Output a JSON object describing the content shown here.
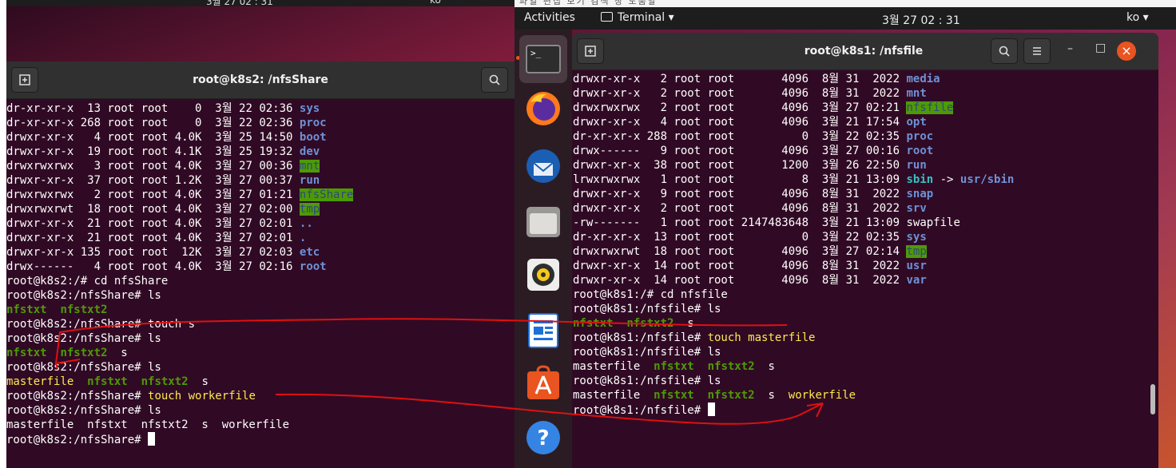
{
  "left": {
    "topbar": {
      "clock": "3월 27 02 : 31",
      "lang": "ko"
    },
    "window": {
      "title": "root@k8s2: /nfsShare",
      "new_tab_icon": "new-tab-icon",
      "search_icon": "search-icon"
    },
    "lines": [
      {
        "text": "dr-xr-xr-x  13 root root    0  3월 22 02:36 ",
        "name": "sys",
        "style": "c-blue"
      },
      {
        "text": "dr-xr-xr-x 268 root root    0  3월 22 02:36 ",
        "name": "proc",
        "style": "c-blue"
      },
      {
        "text": "drwxr-xr-x   4 root root 4.0K  3월 25 14:50 ",
        "name": "boot",
        "style": "c-blue"
      },
      {
        "text": "drwxr-xr-x  19 root root 4.1K  3월 25 19:32 ",
        "name": "dev",
        "style": "c-blue"
      },
      {
        "text": "drwxrwxrwx   3 root root 4.0K  3월 27 00:36 ",
        "name": "mnt",
        "style": "c-ow"
      },
      {
        "text": "drwxr-xr-x  37 root root 1.2K  3월 27 00:37 ",
        "name": "run",
        "style": "c-blue"
      },
      {
        "text": "drwxrwxrwx   2 root root 4.0K  3월 27 01:21 ",
        "name": "nfsShare",
        "style": "c-ow"
      },
      {
        "text": "drwxrwxrwt  18 root root 4.0K  3월 27 02:00 ",
        "name": "tmp",
        "style": "c-ow"
      },
      {
        "text": "drwxr-xr-x  21 root root 4.0K  3월 27 02:01 ",
        "name": "..",
        "style": "c-blue"
      },
      {
        "text": "drwxr-xr-x  21 root root 4.0K  3월 27 02:01 ",
        "name": ".",
        "style": "c-blue"
      },
      {
        "text": "drwxr-xr-x 135 root root  12K  3월 27 02:03 ",
        "name": "etc",
        "style": "c-blue"
      },
      {
        "text": "drwx------   4 root root 4.0K  3월 27 02:16 ",
        "name": "root",
        "style": "c-blue"
      },
      {
        "text": "root@k8s2:/# cd nfsShare"
      },
      {
        "text": "root@k8s2:/nfsShare# ls"
      },
      {
        "parts": [
          {
            "t": "nfstxt",
            "s": "c-green"
          },
          {
            "t": "  "
          },
          {
            "t": "nfstxt2",
            "s": "c-green"
          }
        ]
      },
      {
        "text": "root@k8s2:/nfsShare# touch s"
      },
      {
        "text": "root@k8s2:/nfsShare# ls"
      },
      {
        "parts": [
          {
            "t": "nfstxt",
            "s": "c-green"
          },
          {
            "t": "  "
          },
          {
            "t": "nfstxt2",
            "s": "c-green"
          },
          {
            "t": "  s"
          }
        ]
      },
      {
        "text": "root@k8s2:/nfsShare# ls"
      },
      {
        "parts": [
          {
            "t": "masterfile",
            "s": "c-yellow"
          },
          {
            "t": "  "
          },
          {
            "t": "nfstxt",
            "s": "c-green"
          },
          {
            "t": "  "
          },
          {
            "t": "nfstxt2",
            "s": "c-green"
          },
          {
            "t": "  s"
          }
        ]
      },
      {
        "parts": [
          {
            "t": "root@k8s2:/nfsShare# "
          },
          {
            "t": "touch workerfile",
            "s": "c-yellow"
          }
        ]
      },
      {
        "text": "root@k8s2:/nfsShare# ls"
      },
      {
        "text": "masterfile  nfstxt  nfstxt2  s  workerfile"
      },
      {
        "text": "root@k8s2:/nfsShare# ",
        "cursor": true
      }
    ]
  },
  "right": {
    "ime_strip": "파일  편집  보기  검색  창  도움말",
    "topbar": {
      "activities": "Activities",
      "app_menu": "Terminal",
      "clock": "3월 27  02 : 31",
      "lang": "ko"
    },
    "dock": [
      {
        "name": "terminal",
        "icon": "terminal-icon"
      },
      {
        "name": "firefox",
        "icon": "firefox-icon"
      },
      {
        "name": "thunderbird",
        "icon": "thunderbird-icon"
      },
      {
        "name": "files",
        "icon": "files-icon"
      },
      {
        "name": "rhythmbox",
        "icon": "rhythmbox-icon"
      },
      {
        "name": "libreoffice-writer",
        "icon": "writer-icon"
      },
      {
        "name": "software",
        "icon": "software-icon"
      },
      {
        "name": "help",
        "icon": "help-icon"
      }
    ],
    "window": {
      "title": "root@k8s1: /nfsfile",
      "new_tab_icon": "new-tab-icon",
      "search_icon": "search-icon",
      "menu_icon": "hamburger-icon",
      "minimize": "–",
      "maximize": "□",
      "close": "×"
    },
    "lines": [
      {
        "text": "drwxr-xr-x   2 root root       4096  8월 31  2022 ",
        "name": "media",
        "style": "c-blue"
      },
      {
        "text": "drwxr-xr-x   2 root root       4096  8월 31  2022 ",
        "name": "mnt",
        "style": "c-blue"
      },
      {
        "text": "drwxrwxrwx   2 root root       4096  3월 27 02:21 ",
        "name": "nfsfile",
        "style": "c-ow"
      },
      {
        "text": "drwxr-xr-x   4 root root       4096  3월 21 17:54 ",
        "name": "opt",
        "style": "c-blue"
      },
      {
        "text": "dr-xr-xr-x 288 root root          0  3월 22 02:35 ",
        "name": "proc",
        "style": "c-blue"
      },
      {
        "text": "drwx------   9 root root       4096  3월 27 00:16 ",
        "name": "root",
        "style": "c-blue"
      },
      {
        "text": "drwxr-xr-x  38 root root       1200  3월 26 22:50 ",
        "name": "run",
        "style": "c-blue"
      },
      {
        "parts": [
          {
            "t": "lrwxrwxrwx   1 root root          8  3월 21 13:09 "
          },
          {
            "t": "sbin",
            "s": "c-cyan"
          },
          {
            "t": " -> "
          },
          {
            "t": "usr/sbin",
            "s": "c-blue"
          }
        ]
      },
      {
        "text": "drwxr-xr-x   9 root root       4096  8월 31  2022 ",
        "name": "snap",
        "style": "c-blue"
      },
      {
        "text": "drwxr-xr-x   2 root root       4096  8월 31  2022 ",
        "name": "srv",
        "style": "c-blue"
      },
      {
        "text": "-rw-------   1 root root 2147483648  3월 21 13:09 swapfile"
      },
      {
        "text": "dr-xr-xr-x  13 root root          0  3월 22 02:35 ",
        "name": "sys",
        "style": "c-blue"
      },
      {
        "text": "drwxrwxrwt  18 root root       4096  3월 27 02:14 ",
        "name": "tmp",
        "style": "c-ow"
      },
      {
        "text": "drwxr-xr-x  14 root root       4096  8월 31  2022 ",
        "name": "usr",
        "style": "c-blue"
      },
      {
        "text": "drwxr-xr-x  14 root root       4096  8월 31  2022 ",
        "name": "var",
        "style": "c-blue"
      },
      {
        "text": "root@k8s1:/# cd nfsfile"
      },
      {
        "text": "root@k8s1:/nfsfile# ls"
      },
      {
        "parts": [
          {
            "t": "nfstxt",
            "s": "c-green"
          },
          {
            "t": "  "
          },
          {
            "t": "nfstxt2",
            "s": "c-green"
          },
          {
            "t": "  s"
          }
        ]
      },
      {
        "parts": [
          {
            "t": "root@k8s1:/nfsfile# "
          },
          {
            "t": "touch masterfile",
            "s": "c-yellow"
          }
        ]
      },
      {
        "text": "root@k8s1:/nfsfile# ls"
      },
      {
        "parts": [
          {
            "t": "masterfile  "
          },
          {
            "t": "nfstxt",
            "s": "c-green"
          },
          {
            "t": "  "
          },
          {
            "t": "nfstxt2",
            "s": "c-green"
          },
          {
            "t": "  s"
          }
        ]
      },
      {
        "text": "root@k8s1:/nfsfile# ls"
      },
      {
        "parts": [
          {
            "t": "masterfile  "
          },
          {
            "t": "nfstxt",
            "s": "c-green"
          },
          {
            "t": "  "
          },
          {
            "t": "nfstxt2",
            "s": "c-green"
          },
          {
            "t": "  s  "
          },
          {
            "t": "workerfile",
            "s": "c-yellow"
          }
        ]
      },
      {
        "text": "root@k8s1:/nfsfile# ",
        "cursor": true
      }
    ]
  },
  "colors": {
    "terminal_bg": "#300a24",
    "directory_blue": "#6e91d6",
    "other_writable_bg": "#4e9a06",
    "annotation_red": "#e01010",
    "highlight_yellow": "#fce94f"
  }
}
